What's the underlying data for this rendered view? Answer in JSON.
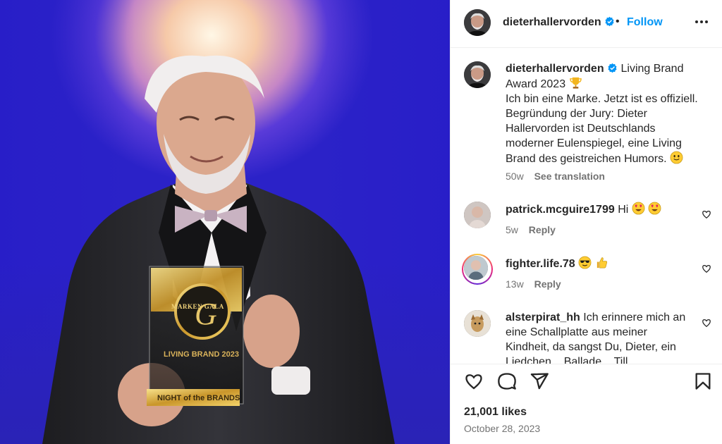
{
  "post": {
    "username": "dieterhallervorden",
    "dot": "•",
    "follow_label": "Follow",
    "caption": {
      "line1": "Living Brand",
      "line2": "Award 2023",
      "line3": "Ich bin eine Marke. Jetzt ist es offiziell.",
      "line4": "Begründung der Jury: Dieter",
      "line5": "Hallervorden ist Deutschlands",
      "line6": "moderner Eulenspiegel, eine Living",
      "line7": "Brand des geistreichen Humors.",
      "age": "50w",
      "see_translation": "See translation"
    },
    "comments": [
      {
        "username": "patrick.mcguire1799",
        "text": "Hi",
        "age": "5w",
        "reply": "Reply"
      },
      {
        "username": "fighter.life.78",
        "text": "",
        "age": "13w",
        "reply": "Reply"
      },
      {
        "username": "alsterpirat_hh",
        "line1": "Ich erinnere mich an",
        "line2": "eine Schallplatte aus meiner",
        "line3": "Kindheit, da sangst Du, Dieter, ein",
        "line4": "Liedchen... Ballade... Till..."
      }
    ],
    "likes": "21,001 likes",
    "date": "October 28, 2023"
  },
  "photo": {
    "award_top_text": "MARKEN GALA",
    "award_middle_text": "LIVING BRAND 2023",
    "award_plate_text": "NIGHT of the BRANDS",
    "award_monogram": "G"
  },
  "icons": {
    "verified": "verified-badge-icon",
    "more": "more-options-icon",
    "like": "heart-icon",
    "comment": "comment-bubble-icon",
    "share": "paper-plane-icon",
    "save": "bookmark-icon",
    "trophy": "trophy-emoji",
    "smile": "slightly-smiling-emoji",
    "heart_eyes": "heart-eyes-emoji",
    "sunglasses": "sunglasses-emoji",
    "thumbs_up": "thumbs-up-emoji"
  },
  "colors": {
    "accent": "#0095f6",
    "text": "#262626",
    "muted": "#737373",
    "photo_bg": "#2b22c8"
  }
}
